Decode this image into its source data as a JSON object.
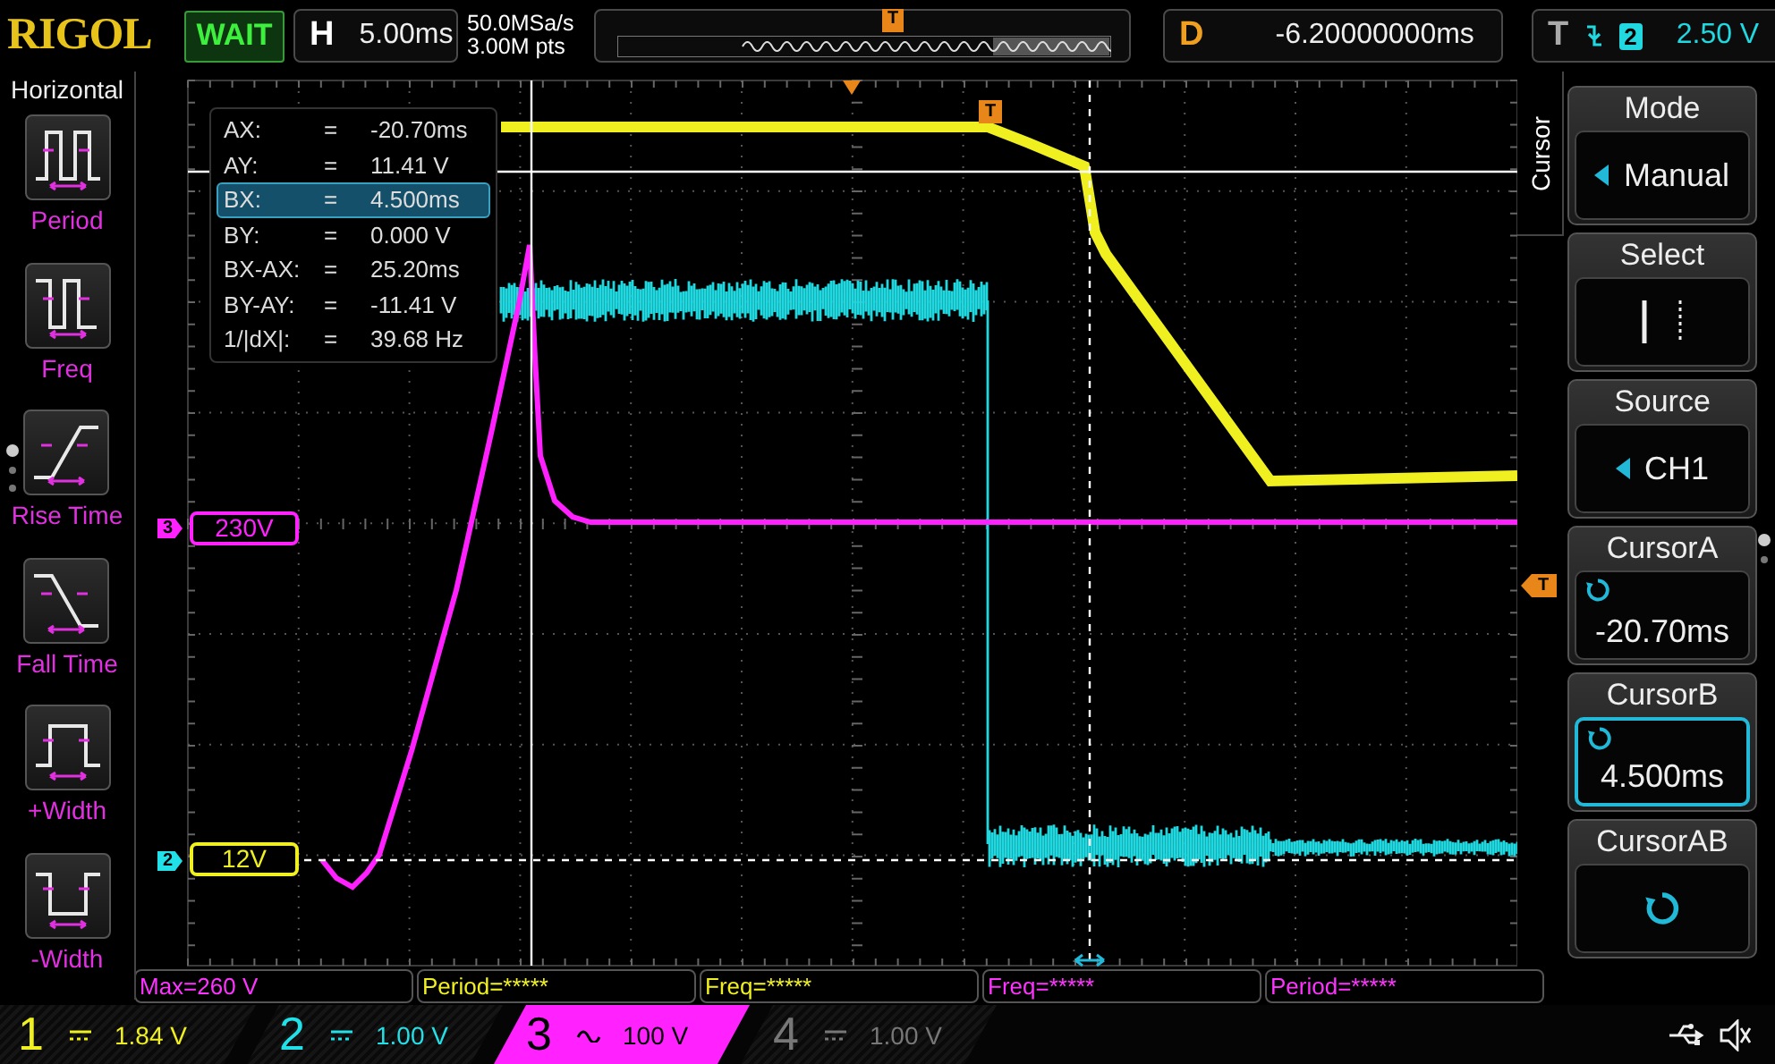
{
  "header": {
    "logo": "RIGOL",
    "status": "WAIT",
    "timebase": {
      "label": "H",
      "value": "5.00ms"
    },
    "sample_rate": "50.0MSa/s",
    "memory_depth": "3.00M pts",
    "memory_marker": "T",
    "delay": {
      "label": "D",
      "value": "-6.20000000ms"
    },
    "trigger": {
      "label": "T",
      "falling_edge": true,
      "source": "2",
      "level": "2.50 V"
    }
  },
  "left_menu": {
    "title": "Horizontal",
    "items": [
      {
        "label": "Period",
        "kind": "period"
      },
      {
        "label": "Freq",
        "kind": "freq"
      },
      {
        "label": "Rise Time",
        "kind": "rise"
      },
      {
        "label": "Fall Time",
        "kind": "fall"
      },
      {
        "label": "+Width",
        "kind": "pwidth"
      },
      {
        "label": "-Width",
        "kind": "nwidth"
      }
    ]
  },
  "cursor_readout": [
    {
      "name": "AX:",
      "sign": "=",
      "value": "-20.70ms",
      "selected": false
    },
    {
      "name": "AY:",
      "sign": "=",
      "value": "11.41 V",
      "selected": false
    },
    {
      "name": "BX:",
      "sign": "=",
      "value": "4.500ms",
      "selected": true
    },
    {
      "name": "BY:",
      "sign": "=",
      "value": "0.000 V",
      "selected": false
    },
    {
      "name": "BX-AX:",
      "sign": "=",
      "value": "25.20ms",
      "selected": false
    },
    {
      "name": "BY-AY:",
      "sign": "=",
      "value": "-11.41 V",
      "selected": false
    },
    {
      "name": "1/|dX|:",
      "sign": "=",
      "value": "39.68 Hz",
      "selected": false
    }
  ],
  "plot_markers": {
    "channel_3": {
      "tag": "3",
      "label": "230V"
    },
    "channel_2": {
      "tag": "2",
      "label": "12V"
    },
    "trigger_time": "T",
    "trigger_level": "T"
  },
  "right_menu": {
    "title": "Cursor",
    "items": [
      {
        "label": "Mode",
        "kind": "select",
        "value": "Manual",
        "selected": false
      },
      {
        "label": "Select",
        "kind": "cursors",
        "selected": false
      },
      {
        "label": "Source",
        "kind": "select",
        "value": "CH1",
        "selected": false
      },
      {
        "label": "CursorA",
        "kind": "knob",
        "value": "-20.70ms",
        "selected": false
      },
      {
        "label": "CursorB",
        "kind": "knob",
        "value": "4.500ms",
        "selected": true
      },
      {
        "label": "CursorAB",
        "kind": "knob",
        "selected": false
      }
    ]
  },
  "measurements": [
    {
      "text": "Max=260 V",
      "color": "#ff33ff"
    },
    {
      "text": "Period=*****",
      "color": "#f0f020"
    },
    {
      "text": "Freq=*****",
      "color": "#f0f020"
    },
    {
      "text": "Freq=*****",
      "color": "#ff33ff"
    },
    {
      "text": "Period=*****",
      "color": "#ff33ff"
    }
  ],
  "channels": [
    {
      "number": "1",
      "ac_coupled": false,
      "scale": "1.84 V",
      "color": "#f0f020",
      "active": false
    },
    {
      "number": "2",
      "ac_coupled": false,
      "scale": "1.00 V",
      "color": "#22e0e8",
      "active": false
    },
    {
      "number": "3",
      "ac_coupled": true,
      "scale": "100 V",
      "color": "#ff22ff",
      "active": true
    },
    {
      "number": "4",
      "ac_coupled": false,
      "scale": "1.00 V",
      "color": "#777777",
      "active": false
    }
  ]
}
